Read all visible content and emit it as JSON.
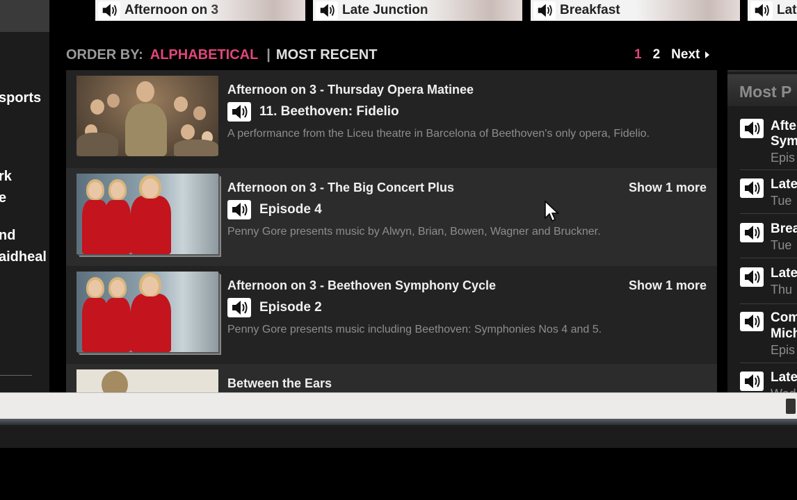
{
  "top_carousel": [
    {
      "label": "Afternoon on 3"
    },
    {
      "label": "Late Junction"
    },
    {
      "label": "Breakfast"
    },
    {
      "label": "Lat"
    }
  ],
  "left_nav": {
    "items": [
      "sports",
      "rk",
      "e",
      "nd",
      "aidheal"
    ]
  },
  "order_by": {
    "label": "ORDER BY:",
    "options": [
      "ALPHABETICAL",
      "MOST RECENT"
    ],
    "separator": "|",
    "active": "ALPHABETICAL"
  },
  "pagination": {
    "pages": [
      "1",
      "2"
    ],
    "current": "1",
    "next_label": "Next"
  },
  "episodes": [
    {
      "title": "Afternoon on 3 - Thursday Opera Matinee",
      "episode": "11. Beethoven: Fidelio",
      "description": "A performance from the Liceu theatre in Barcelona of Beethoven's only opera, Fidelio.",
      "show_more": ""
    },
    {
      "title": "Afternoon on 3 - The Big Concert Plus",
      "episode": "Episode 4",
      "description": "Penny Gore presents music by Alwyn, Brian, Bowen, Wagner and Bruckner.",
      "show_more": "Show 1 more"
    },
    {
      "title": "Afternoon on 3 - Beethoven Symphony Cycle",
      "episode": "Episode 2",
      "description": "Penny Gore presents music including Beethoven: Symphonies Nos 4 and 5.",
      "show_more": "Show 1 more"
    },
    {
      "title": "Between the Ears",
      "episode": "",
      "description": "",
      "show_more": ""
    }
  ],
  "most_popular": {
    "title": "Most P",
    "items": [
      {
        "title": "Afte",
        "title2": "Sym",
        "sub": "Epis"
      },
      {
        "title": "Late",
        "title2": "",
        "sub": "Tue"
      },
      {
        "title": "Brea",
        "title2": "",
        "sub": "Tue"
      },
      {
        "title": "Late",
        "title2": "",
        "sub": "Thu"
      },
      {
        "title": "Com",
        "title2": "Mich",
        "sub": "Epis"
      },
      {
        "title": "Late",
        "title2": "",
        "sub": "Wed"
      }
    ]
  },
  "colors": {
    "accent_pink": "#e0467a",
    "background": "#000000",
    "row_dark": "#232323",
    "row_light": "#2c2c2c"
  },
  "icons": [
    "speaker-icon",
    "chevron-right-icon",
    "mouse-cursor-icon"
  ]
}
